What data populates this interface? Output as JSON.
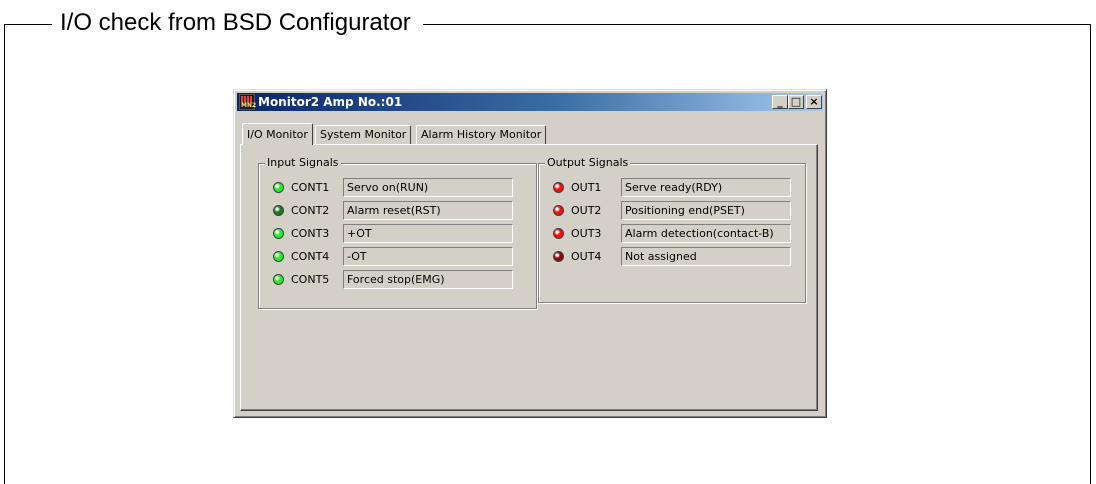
{
  "frame": {
    "title": "I/O check from BSD Configurator"
  },
  "window": {
    "title": "Monitor2  Amp No.:01",
    "app_icon_text": "MN2",
    "buttons": {
      "minimize": "_",
      "maximize": "□",
      "close": "×"
    }
  },
  "tabs": [
    {
      "label": "I/O Monitor",
      "active": true
    },
    {
      "label": "System Monitor",
      "active": false
    },
    {
      "label": "Alarm History Monitor",
      "active": false
    }
  ],
  "input_signals": {
    "title": "Input Signals",
    "items": [
      {
        "label": "CONT1",
        "desc": "Servo on(RUN)",
        "led_color": "#22ee22"
      },
      {
        "label": "CONT2",
        "desc": "Alarm reset(RST)",
        "led_color": "#1a7a1a"
      },
      {
        "label": "CONT3",
        "desc": "+OT",
        "led_color": "#22ee22"
      },
      {
        "label": "CONT4",
        "desc": "-OT",
        "led_color": "#22ee22"
      },
      {
        "label": "CONT5",
        "desc": "Forced stop(EMG)",
        "led_color": "#22ee22"
      }
    ]
  },
  "output_signals": {
    "title": "Output Signals",
    "items": [
      {
        "label": "OUT1",
        "desc": "Serve ready(RDY)",
        "led_color": "#ee1111"
      },
      {
        "label": "OUT2",
        "desc": "Positioning end(PSET)",
        "led_color": "#ee1111"
      },
      {
        "label": "OUT3",
        "desc": "Alarm detection(contact-B)",
        "led_color": "#ee1111"
      },
      {
        "label": "OUT4",
        "desc": "Not assigned",
        "led_color": "#8a0a0a"
      }
    ]
  }
}
